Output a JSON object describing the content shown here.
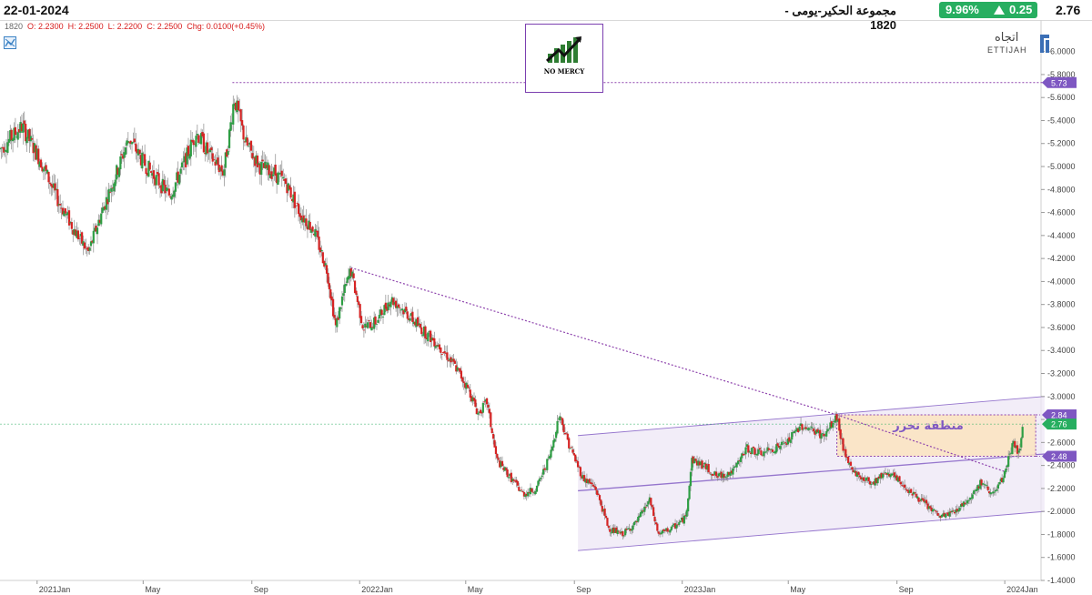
{
  "header": {
    "date": "22-01-2024",
    "symbol_title": "مجموعة الحكير-يومى - 1820",
    "change_pct": "9.96%",
    "change_abs": "0.25",
    "last_price": "2.76",
    "up_color": "#27ae60"
  },
  "ohlc_bar": {
    "symbol": "1820",
    "open": "O: 2.2300",
    "high": "H: 2.2500",
    "low": "L: 2.2200",
    "close": "C: 2.2500",
    "chg": "Chg: 0.0100(+0.45%)"
  },
  "logo": {
    "arabic": "اتجاه",
    "latin": "ETTIJAH"
  },
  "watermark": {
    "label": "NO MERCY"
  },
  "icons": {
    "toolbar": "indicator-tool-icon",
    "logo": "ettijah-logo-icon",
    "watermark": "growth-chart-icon"
  },
  "zone_label": "منطقة تحرر",
  "chart_data": {
    "type": "candlestick",
    "ylim": [
      1.4,
      6.1
    ],
    "y_ticks": [
      "6.0000",
      "5.8000",
      "5.6000",
      "5.4000",
      "5.2000",
      "5.0000",
      "4.8000",
      "4.6000",
      "4.4000",
      "4.2000",
      "4.0000",
      "3.8000",
      "3.6000",
      "3.4000",
      "3.2000",
      "3.0000",
      "2.8000",
      "2.6000",
      "2.4000",
      "2.2000",
      "2.0000",
      "1.8000",
      "1.6000",
      "1.4000"
    ],
    "x_ticks": [
      "2021Jan",
      "May",
      "Sep",
      "2022Jan",
      "May",
      "Sep",
      "2023Jan",
      "May",
      "Sep",
      "2024Jan"
    ],
    "price_tags": [
      {
        "label": "5.73",
        "value": 5.73,
        "color": "#7e57c2"
      },
      {
        "label": "2.84",
        "value": 2.84,
        "color": "#7e57c2"
      },
      {
        "label": "2.76",
        "value": 2.76,
        "color": "#27ae60"
      },
      {
        "label": "2.48",
        "value": 2.48,
        "color": "#7e57c2"
      }
    ],
    "series": [
      {
        "name": "price",
        "points": [
          {
            "date": "2020-11-20",
            "value": 5.15
          },
          {
            "date": "2020-12-15",
            "value": 5.35
          },
          {
            "date": "2021-01-05",
            "value": 5.05
          },
          {
            "date": "2021-01-25",
            "value": 4.7
          },
          {
            "date": "2021-02-12",
            "value": 4.45
          },
          {
            "date": "2021-02-28",
            "value": 4.25
          },
          {
            "date": "2021-03-15",
            "value": 4.6
          },
          {
            "date": "2021-04-01",
            "value": 4.95
          },
          {
            "date": "2021-04-15",
            "value": 5.25
          },
          {
            "date": "2021-04-30",
            "value": 5.05
          },
          {
            "date": "2021-05-15",
            "value": 4.9
          },
          {
            "date": "2021-05-31",
            "value": 4.75
          },
          {
            "date": "2021-06-15",
            "value": 5.0
          },
          {
            "date": "2021-06-30",
            "value": 5.3
          },
          {
            "date": "2021-07-15",
            "value": 5.1
          },
          {
            "date": "2021-07-31",
            "value": 4.95
          },
          {
            "date": "2021-08-06",
            "value": 5.25
          },
          {
            "date": "2021-08-12",
            "value": 5.6
          },
          {
            "date": "2021-08-25",
            "value": 5.2
          },
          {
            "date": "2021-09-10",
            "value": 5.0
          },
          {
            "date": "2021-09-25",
            "value": 4.95
          },
          {
            "date": "2021-10-10",
            "value": 4.85
          },
          {
            "date": "2021-10-25",
            "value": 4.6
          },
          {
            "date": "2021-11-10",
            "value": 4.45
          },
          {
            "date": "2021-11-25",
            "value": 4.1
          },
          {
            "date": "2021-12-05",
            "value": 3.6
          },
          {
            "date": "2021-12-12",
            "value": 3.85
          },
          {
            "date": "2021-12-22",
            "value": 4.1
          },
          {
            "date": "2022-01-05",
            "value": 3.6
          },
          {
            "date": "2022-01-20",
            "value": 3.65
          },
          {
            "date": "2022-02-05",
            "value": 3.85
          },
          {
            "date": "2022-02-20",
            "value": 3.75
          },
          {
            "date": "2022-03-10",
            "value": 3.6
          },
          {
            "date": "2022-03-31",
            "value": 3.45
          },
          {
            "date": "2022-04-20",
            "value": 3.25
          },
          {
            "date": "2022-05-05",
            "value": 3.05
          },
          {
            "date": "2022-05-15",
            "value": 2.85
          },
          {
            "date": "2022-05-25",
            "value": 2.95
          },
          {
            "date": "2022-06-05",
            "value": 2.45
          },
          {
            "date": "2022-06-20",
            "value": 2.3
          },
          {
            "date": "2022-07-05",
            "value": 2.15
          },
          {
            "date": "2022-07-20",
            "value": 2.2
          },
          {
            "date": "2022-08-05",
            "value": 2.5
          },
          {
            "date": "2022-08-15",
            "value": 2.85
          },
          {
            "date": "2022-08-25",
            "value": 2.6
          },
          {
            "date": "2022-09-10",
            "value": 2.3
          },
          {
            "date": "2022-09-25",
            "value": 2.2
          },
          {
            "date": "2022-10-10",
            "value": 1.85
          },
          {
            "date": "2022-10-25",
            "value": 1.8
          },
          {
            "date": "2022-11-10",
            "value": 1.9
          },
          {
            "date": "2022-11-25",
            "value": 2.1
          },
          {
            "date": "2022-12-05",
            "value": 1.8
          },
          {
            "date": "2022-12-20",
            "value": 1.85
          },
          {
            "date": "2023-01-05",
            "value": 1.95
          },
          {
            "date": "2023-01-12",
            "value": 2.45
          },
          {
            "date": "2023-01-25",
            "value": 2.4
          },
          {
            "date": "2023-02-10",
            "value": 2.3
          },
          {
            "date": "2023-02-28",
            "value": 2.35
          },
          {
            "date": "2023-03-15",
            "value": 2.55
          },
          {
            "date": "2023-03-31",
            "value": 2.5
          },
          {
            "date": "2023-04-15",
            "value": 2.55
          },
          {
            "date": "2023-04-30",
            "value": 2.6
          },
          {
            "date": "2023-05-15",
            "value": 2.75
          },
          {
            "date": "2023-05-31",
            "value": 2.7
          },
          {
            "date": "2023-06-10",
            "value": 2.65
          },
          {
            "date": "2023-06-25",
            "value": 2.82
          },
          {
            "date": "2023-07-05",
            "value": 2.45
          },
          {
            "date": "2023-07-20",
            "value": 2.3
          },
          {
            "date": "2023-08-05",
            "value": 2.25
          },
          {
            "date": "2023-08-20",
            "value": 2.35
          },
          {
            "date": "2023-09-05",
            "value": 2.25
          },
          {
            "date": "2023-09-20",
            "value": 2.15
          },
          {
            "date": "2023-10-05",
            "value": 2.05
          },
          {
            "date": "2023-10-20",
            "value": 1.95
          },
          {
            "date": "2023-11-05",
            "value": 2.0
          },
          {
            "date": "2023-11-20",
            "value": 2.1
          },
          {
            "date": "2023-12-05",
            "value": 2.25
          },
          {
            "date": "2023-12-20",
            "value": 2.15
          },
          {
            "date": "2023-12-31",
            "value": 2.3
          },
          {
            "date": "2024-01-10",
            "value": 2.6
          },
          {
            "date": "2024-01-18",
            "value": 2.5
          },
          {
            "date": "2024-01-22",
            "value": 2.76
          }
        ]
      }
    ],
    "annotations": {
      "high_line": {
        "value": 5.73,
        "from": "2021-08-10",
        "to": "2024-02-15"
      },
      "downtrend": {
        "from": {
          "date": "2021-12-22",
          "value": 4.12
        },
        "to": {
          "date": "2023-06-25",
          "value": 2.84
        }
      },
      "downtrend_ext": {
        "from": {
          "date": "2023-06-25",
          "value": 2.84
        },
        "to": {
          "date": "2023-12-31",
          "value": 2.35
        }
      },
      "channel_upper": {
        "from": {
          "date": "2022-09-05",
          "value": 2.66
        },
        "to": {
          "date": "2024-02-15",
          "value": 3.0
        }
      },
      "channel_mid": {
        "from": {
          "date": "2022-09-05",
          "value": 2.18
        },
        "to": {
          "date": "2024-02-15",
          "value": 2.5
        }
      },
      "channel_lower": {
        "from": {
          "date": "2022-09-05",
          "value": 1.66
        },
        "to": {
          "date": "2024-02-15",
          "value": 2.0
        }
      },
      "zone": {
        "from": "2023-06-25",
        "to": "2024-02-05",
        "top": 2.84,
        "bottom": 2.48
      },
      "current_price_line": 2.76
    }
  }
}
